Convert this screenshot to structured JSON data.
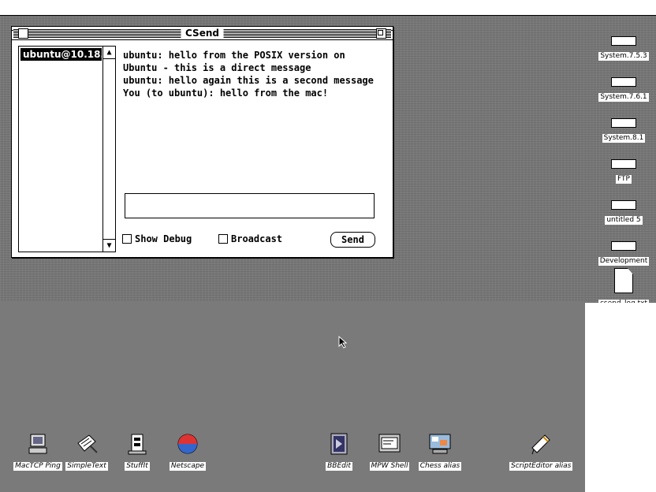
{
  "window": {
    "title": "CSend",
    "users": [
      "ubuntu@10.18..."
    ],
    "messages": [
      "ubuntu: hello from the POSIX version on",
      "Ubuntu - this is a direct message",
      "ubuntu: hello again this is a second message",
      "You (to ubuntu): hello from the mac!"
    ],
    "input_value": "",
    "show_debug_label": "Show Debug",
    "broadcast_label": "Broadcast",
    "send_label": "Send"
  },
  "desktop": {
    "volumes": [
      {
        "label": "System.7.5.3"
      },
      {
        "label": "System.7.6.1"
      },
      {
        "label": "System.8.1"
      },
      {
        "label": "FTP"
      },
      {
        "label": "untitled 5"
      },
      {
        "label": "Development"
      },
      {
        "label": "csend_log.txt"
      }
    ],
    "apps": [
      {
        "label": "MacTCP Ping",
        "icon": "computer-icon"
      },
      {
        "label": "SimpleText",
        "icon": "text-editor-icon"
      },
      {
        "label": "StuffIt",
        "icon": "archive-icon"
      },
      {
        "label": "Netscape",
        "icon": "browser-icon"
      },
      {
        "label": "BBEdit",
        "icon": "editor-icon"
      },
      {
        "label": "MPW Shell",
        "icon": "terminal-icon"
      },
      {
        "label": "Chess alias",
        "icon": "chess-icon"
      },
      {
        "label": "ScriptEditor alias",
        "icon": "script-icon"
      }
    ]
  }
}
